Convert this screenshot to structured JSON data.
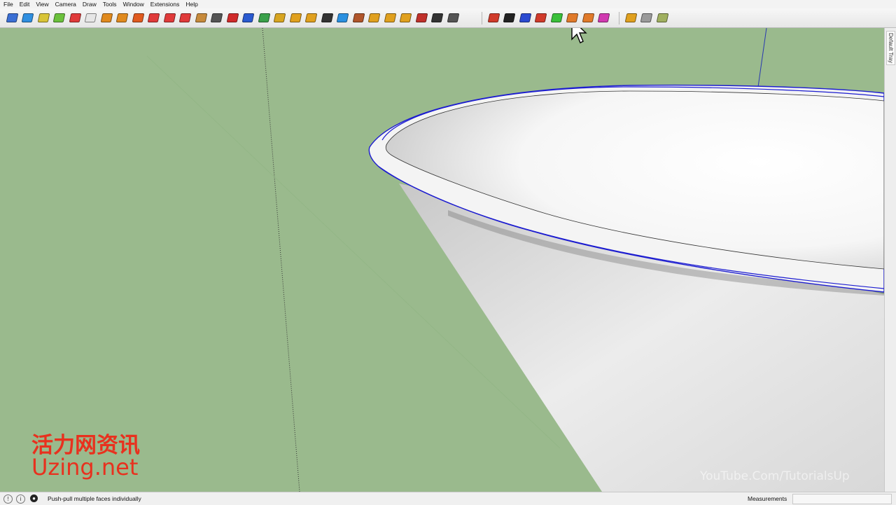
{
  "menu": [
    "File",
    "Edit",
    "View",
    "Camera",
    "Draw",
    "Tools",
    "Window",
    "Extensions",
    "Help"
  ],
  "toolbar": {
    "icons": [
      {
        "name": "iso-view-icon",
        "color": "#3b6fd4"
      },
      {
        "name": "top-view-icon",
        "color": "#2f8fe0"
      },
      {
        "name": "front-view-icon",
        "color": "#d8c437"
      },
      {
        "name": "right-view-icon",
        "color": "#6bc13c"
      },
      {
        "name": "back-view-icon",
        "color": "#e03a3a"
      },
      {
        "name": "left-view-icon",
        "color": "#e6e6e6"
      },
      {
        "name": "orbit-icon",
        "color": "#e08a1e"
      },
      {
        "name": "pan-icon",
        "color": "#e08a1e"
      },
      {
        "name": "zoom-icon",
        "color": "#e05a1e"
      },
      {
        "name": "rectangle-icon",
        "color": "#e03a3a"
      },
      {
        "name": "section-plane-icon",
        "color": "#e03a3a"
      },
      {
        "name": "flag-icon",
        "color": "#e03a3a"
      },
      {
        "name": "box-icon",
        "color": "#c78a3b"
      },
      {
        "name": "follow-me-icon",
        "color": "#555555"
      },
      {
        "name": "curve-icon",
        "color": "#d02a2a"
      },
      {
        "name": "bezier-icon",
        "color": "#2a5ad0"
      },
      {
        "name": "triangle-icon",
        "color": "#3aa04a"
      },
      {
        "name": "warning-icon",
        "color": "#d8a520"
      },
      {
        "name": "rotate-icon",
        "color": "#e0a01e"
      },
      {
        "name": "refresh-icon",
        "color": "#e0a01e"
      },
      {
        "name": "gear-icon",
        "color": "#333333"
      },
      {
        "name": "move-icon",
        "color": "#2a90e0"
      },
      {
        "name": "cube-icon",
        "color": "#b0552a"
      },
      {
        "name": "grid-icon",
        "color": "#e0a01e"
      },
      {
        "name": "grid-icon",
        "color": "#e0a01e"
      },
      {
        "name": "grid-icon",
        "color": "#e0a01e"
      },
      {
        "name": "scatter-icon",
        "color": "#c0302a"
      },
      {
        "name": "arc-icon",
        "color": "#333333"
      },
      {
        "name": "component-icon",
        "color": "#555555"
      },
      {
        "name": "push-pull-icon",
        "color": "#d03a2a"
      },
      {
        "name": "push-pull-icon",
        "color": "#222222"
      },
      {
        "name": "push-pull-icon",
        "color": "#2a4ad0"
      },
      {
        "name": "push-pull-icon",
        "color": "#d03a2a"
      },
      {
        "name": "push-pull-icon",
        "color": "#3ac03a"
      },
      {
        "name": "push-pull-icon",
        "color": "#e07a2a"
      },
      {
        "name": "push-pull-icon",
        "color": "#e07a2a"
      },
      {
        "name": "push-pull-icon",
        "color": "#d03ab0"
      },
      {
        "name": "solid-icon",
        "color": "#e0a01e"
      },
      {
        "name": "solid-icon",
        "color": "#9a9a9a"
      },
      {
        "name": "solid-icon",
        "color": "#a0b060"
      }
    ]
  },
  "tray": {
    "label": "Default Tray"
  },
  "status": {
    "message": "Push-pull multiple faces individually",
    "measurements_label": "Measurements",
    "measurements_value": ""
  },
  "watermark": {
    "cn": "活力网资讯",
    "en": "Uzing.net",
    "yt": "YouTube.Com/TutorialsUp"
  },
  "colors": {
    "viewport_bg": "#9aba8d",
    "selection": "#1c1cd0",
    "watermark": "#e8311e"
  }
}
